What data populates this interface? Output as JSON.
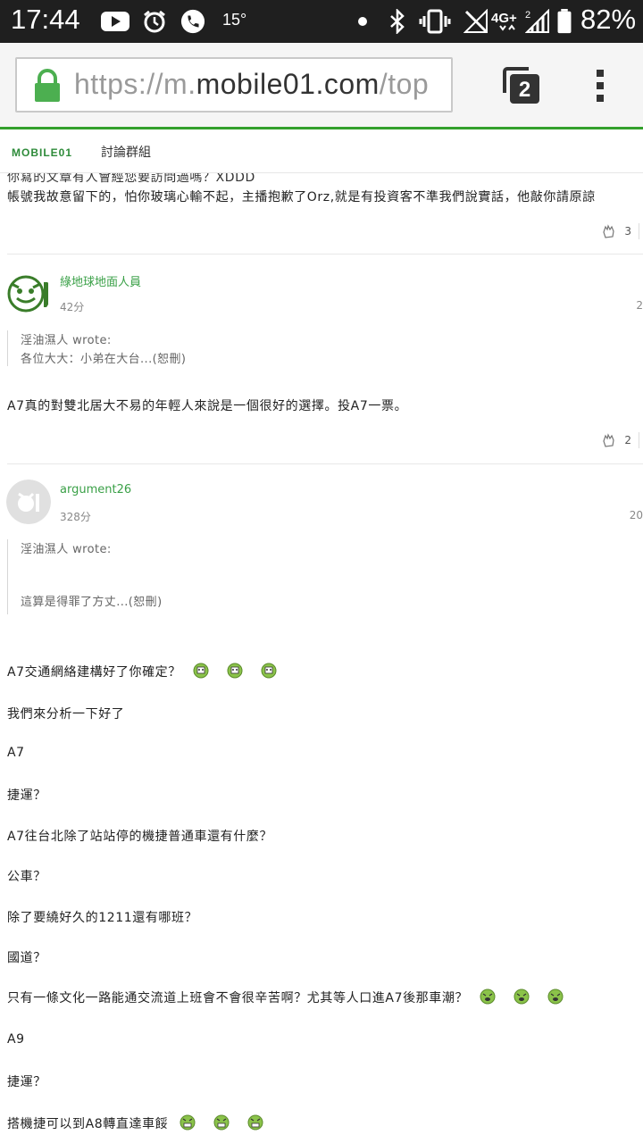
{
  "status_bar": {
    "time": "17:44",
    "temperature": "15°",
    "battery": "82%",
    "icons": [
      "youtube-icon",
      "alarm-icon",
      "phone-icon",
      "dot-icon",
      "bluetooth-icon",
      "vibrate-icon",
      "no-signal-icon",
      "4g-icon",
      "signal-icon",
      "battery-icon"
    ]
  },
  "browser": {
    "url_prefix": "https://m.",
    "url_host": "mobile01.com",
    "url_suffix": "/top",
    "tab_count": "2"
  },
  "site": {
    "logo_text": "MOBILE01",
    "nav_label": "討論群組"
  },
  "posts": {
    "top_partial": {
      "cut_line": "你寫的文章有人會經您要訪問過嗎？XDDD",
      "line": "帳號我故意留下的，怕你玻璃心輸不起，主播抱歉了Orz,就是有投資客不準我們說實話，他敲你請原諒",
      "likes": "3"
    },
    "post1": {
      "username": "綠地球地面人員",
      "time": "42分",
      "floor": "2",
      "quote_author": "淫油濕人 wrote:",
      "quote_text": "各位大大：小弟在大台...(恕刪)",
      "body": "A7真的對雙北居大不易的年輕人來說是一個很好的選擇。投A7一票。",
      "likes": "2"
    },
    "post2": {
      "username": "argument26",
      "time": "328分",
      "floor": "20",
      "quote_author": "淫油濕人 wrote:",
      "quote_text": "這算是得罪了方丈...(恕刪)",
      "lines": [
        "A7交通網絡建構好了你確定？",
        "我們來分析一下好了",
        "A7",
        "捷運？",
        "A7往台北除了站站停的機捷普通車還有什麼？",
        "公車？",
        "除了要繞好久的1211還有哪班？",
        "國道？",
        "只有一條文化一路能通交流道上班會不會很辛苦啊？尤其等人口進A7後那車潮？",
        "A9",
        "捷運？",
        "搭機捷可以到A8轉直達車餒"
      ]
    }
  },
  "colors": {
    "accent_green": "#33a02c",
    "username_green": "#3aa047",
    "status_bar_bg": "#1f1f1f"
  }
}
